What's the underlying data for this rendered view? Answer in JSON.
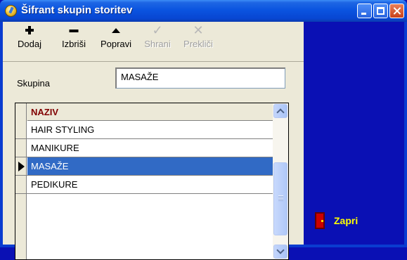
{
  "window": {
    "title": "Šifrant skupin storitev"
  },
  "toolbar": {
    "buttons": [
      {
        "label": "Dodaj",
        "icon": "plus-icon",
        "enabled": true
      },
      {
        "label": "Izbriši",
        "icon": "minus-icon",
        "enabled": true
      },
      {
        "label": "Popravi",
        "icon": "triangle-up-icon",
        "enabled": true
      },
      {
        "label": "Shrani",
        "icon": "checkmark-icon",
        "enabled": false
      },
      {
        "label": "Prekliči",
        "icon": "x-icon",
        "enabled": false
      }
    ]
  },
  "form": {
    "skupina_label": "Skupina",
    "skupina_value": "MASAŽE"
  },
  "grid": {
    "column_header": "NAZIV",
    "rows": [
      "HAIR STYLING",
      "MANIKURE",
      "MASAŽE",
      "PEDIKURE"
    ],
    "selected_index": 2
  },
  "side": {
    "close_label": "Zapri"
  },
  "colors": {
    "selection": "#316ac5",
    "side_panel": "#0a10b4",
    "header_text": "#800000",
    "close_label": "#ffff00"
  }
}
